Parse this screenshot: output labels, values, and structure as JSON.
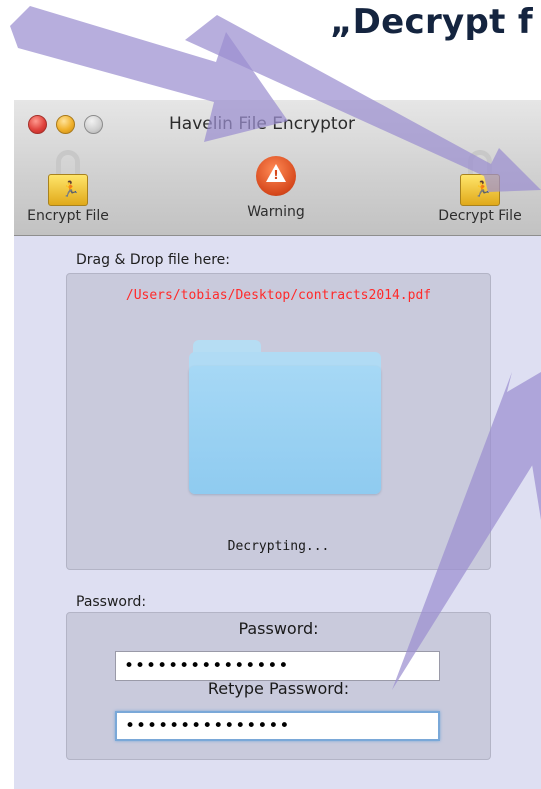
{
  "heading": "„Decrypt f",
  "window": {
    "title": "Havelin File Encryptor",
    "toolbar": {
      "encrypt_label": "Encrypt File",
      "warning_label": "Warning",
      "decrypt_label": "Decrypt File"
    },
    "drop": {
      "label": "Drag & Drop file here:",
      "path": "/Users/tobias/Desktop/contracts2014.pdf",
      "status": "Decrypting..."
    },
    "password_group": {
      "label": "Password:",
      "password_label": "Password:",
      "password_value": "•••••••••••••••",
      "retype_label": "Retype Password:",
      "retype_value": "•••••••••••••••"
    }
  },
  "colors": {
    "arrow": "#9b8fd0",
    "window_bg": "#dedff2",
    "path_text": "#ff2a2a"
  }
}
